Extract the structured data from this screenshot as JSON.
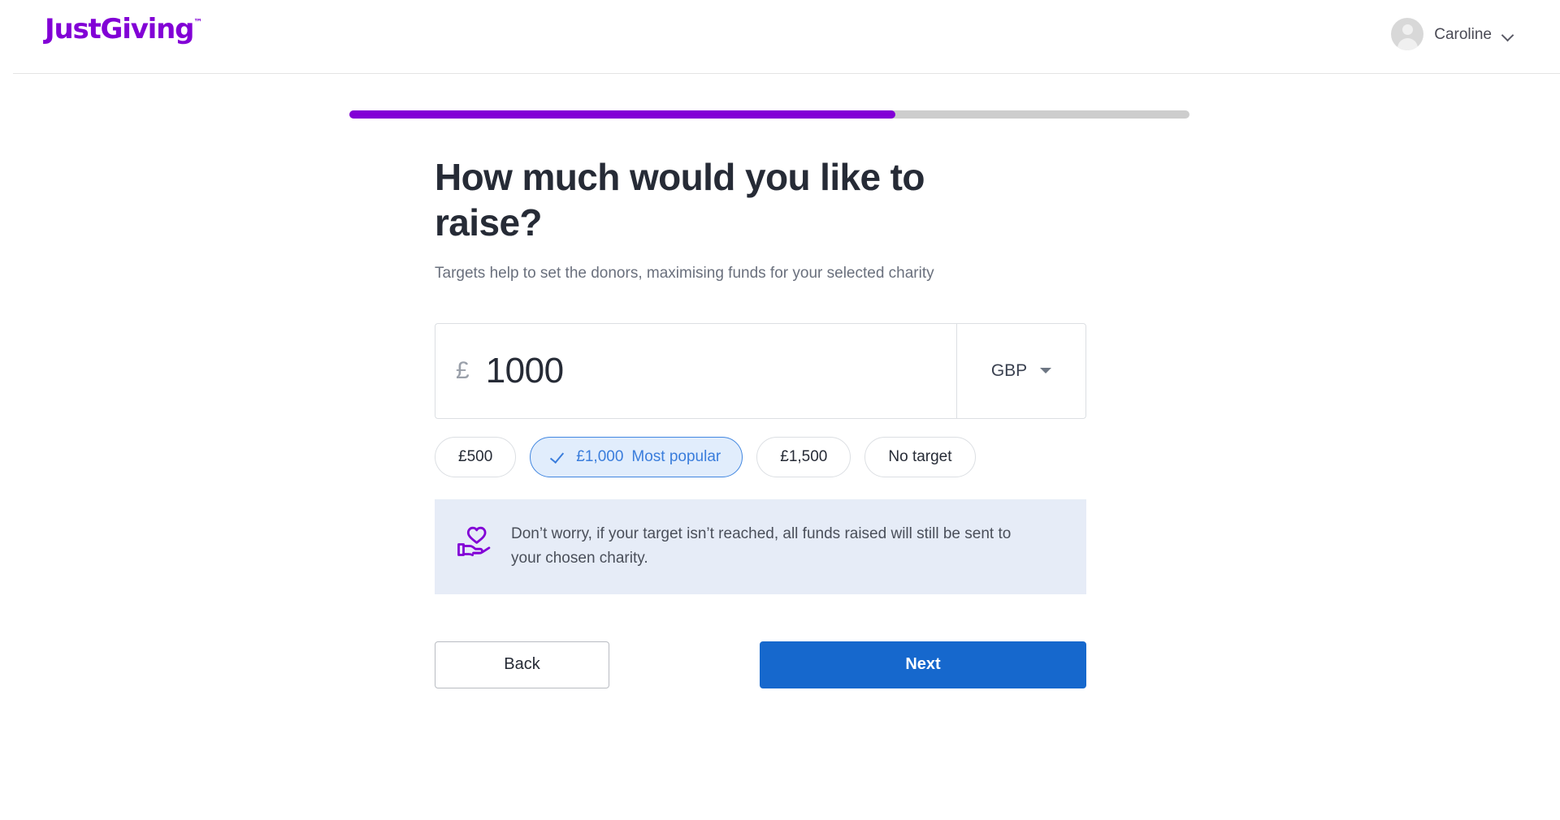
{
  "header": {
    "logo_text": "JustGiving",
    "logo_tm": "™",
    "account_name": "Caroline",
    "brand_color": "#8200d6"
  },
  "progress": {
    "percent": 65,
    "fill_color": "#8200d6",
    "track_color": "#cdcdcd"
  },
  "form": {
    "heading": "How much would you like to raise?",
    "subtitle": "Targets help to set the donors, maximising funds for your selected charity",
    "amount": {
      "currency_symbol": "£",
      "value": "1000",
      "placeholder": "0",
      "currency_code": "GBP"
    },
    "chips": [
      {
        "label": "£500",
        "note": "",
        "selected": false
      },
      {
        "label": "£1,000",
        "note": "Most popular",
        "selected": true
      },
      {
        "label": "£1,500",
        "note": "",
        "selected": false
      },
      {
        "label": "No target",
        "note": "",
        "selected": false
      }
    ],
    "banner": {
      "text": "Don’t worry, if your target isn’t reached, all funds raised will still be sent to your chosen charity.",
      "icon": "hand-heart-icon",
      "background": "#e6ecf7",
      "icon_color": "#8200d6"
    },
    "actions": {
      "back_label": "Back",
      "next_label": "Next",
      "next_color": "#1668cd"
    }
  }
}
